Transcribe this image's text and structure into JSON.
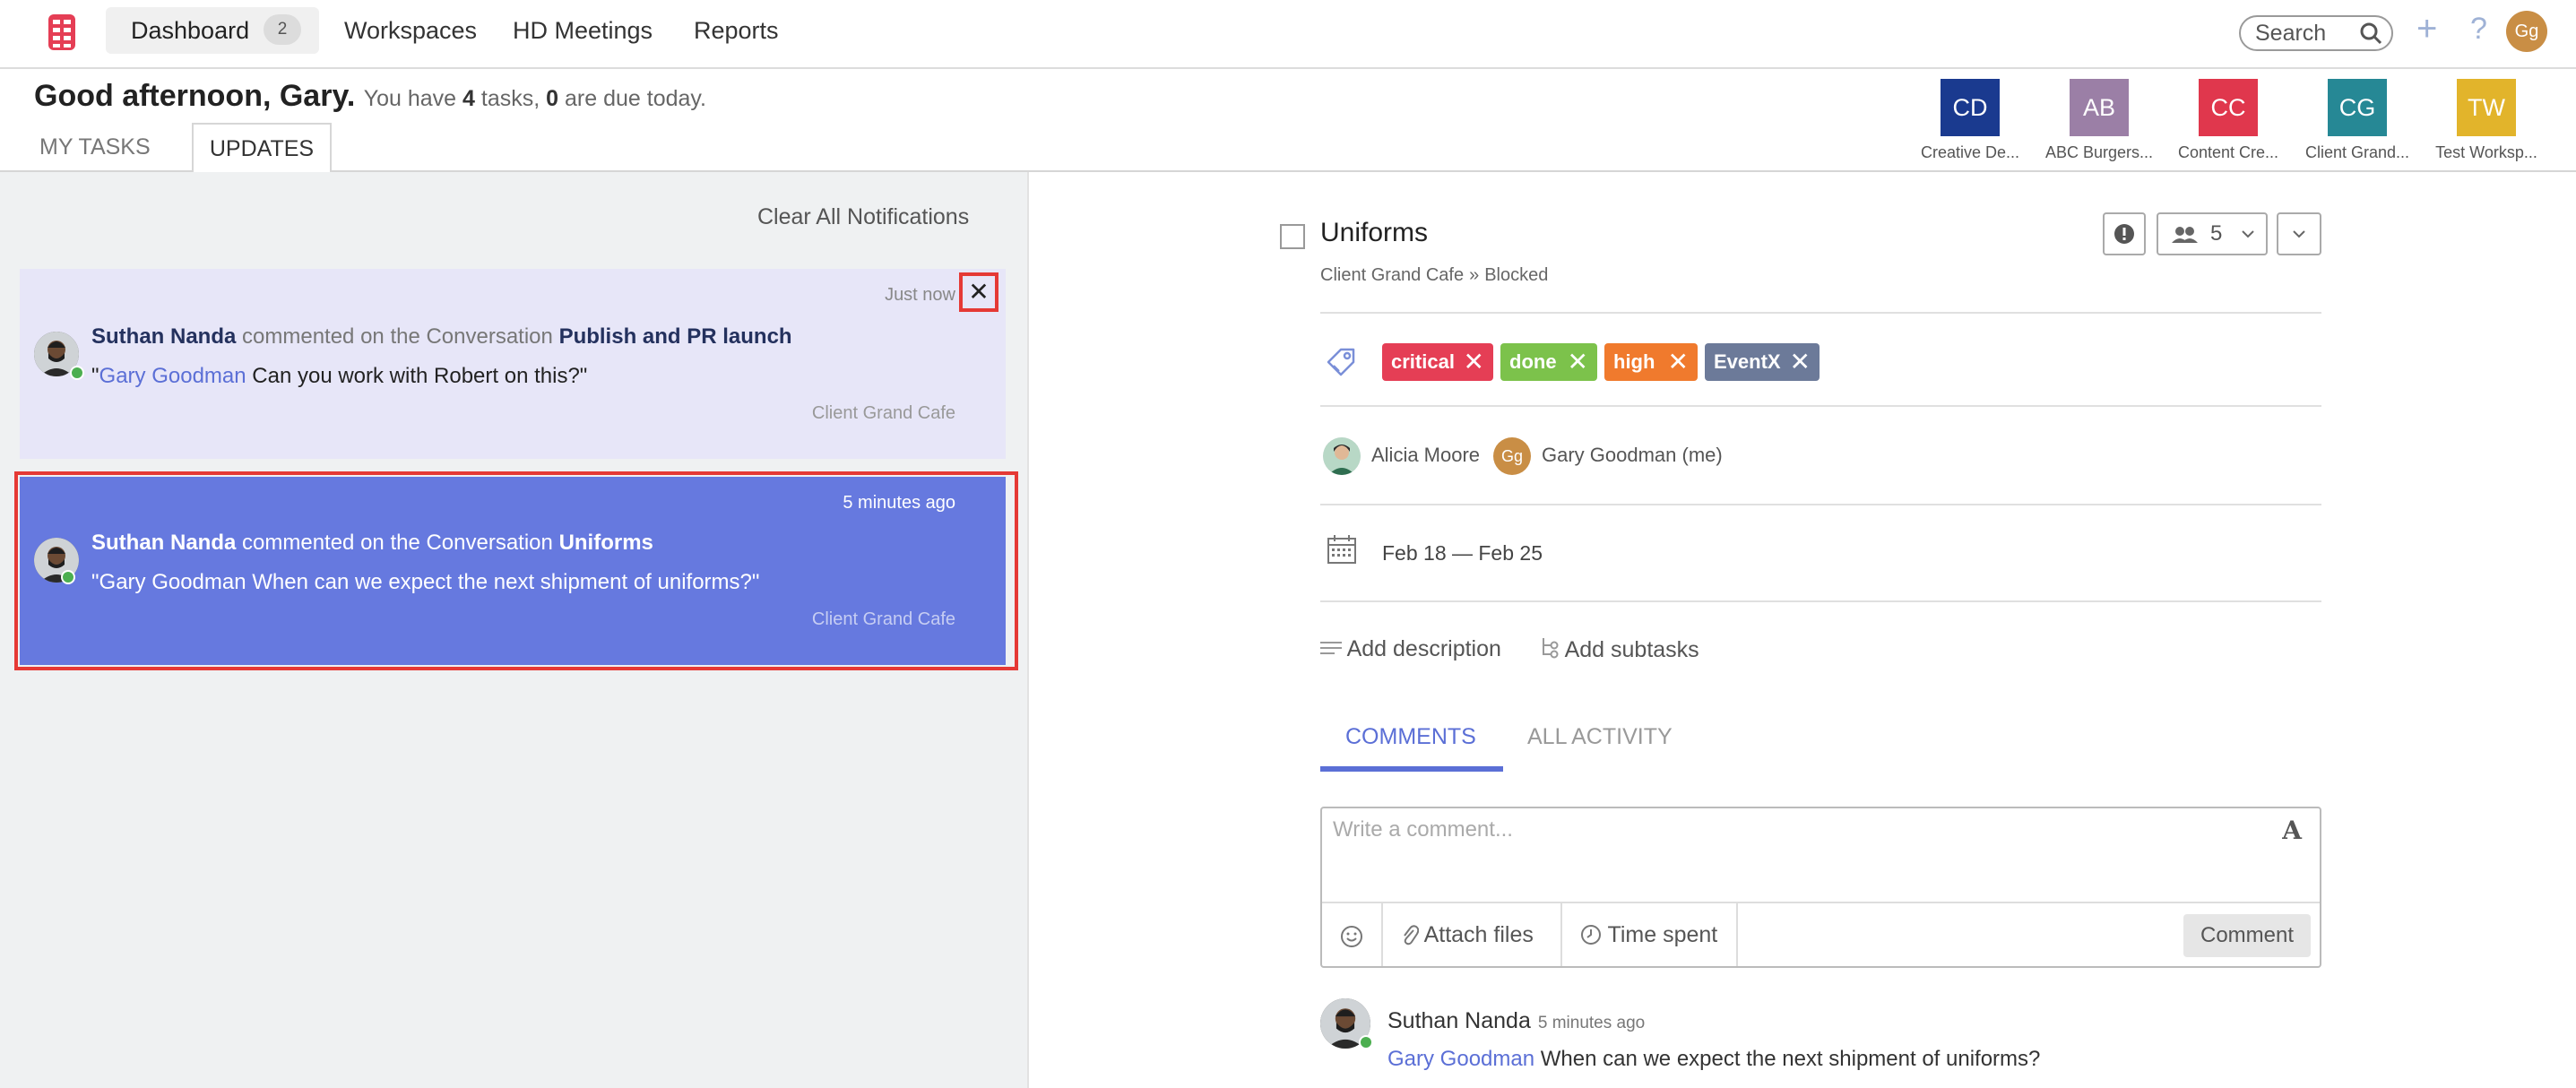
{
  "nav": {
    "dashboard": "Dashboard",
    "dashboard_badge": "2",
    "workspaces": "Workspaces",
    "hd_meetings": "HD Meetings",
    "reports": "Reports",
    "search_placeholder": "Search",
    "plus": "+",
    "help": "?",
    "user_initials": "Gg"
  },
  "greeting": {
    "hello": "Good afternoon, Gary.",
    "you_have": "You have",
    "task_count": "4",
    "tasks_word": "tasks,",
    "due_count": "0",
    "due_text": "are due today."
  },
  "tabs": {
    "my_tasks": "MY TASKS",
    "updates": "UPDATES"
  },
  "workspaces": [
    {
      "initials": "CD",
      "label": "Creative De...",
      "color": "#1a3a8f"
    },
    {
      "initials": "AB",
      "label": "ABC Burgers...",
      "color": "#9b7fa6"
    },
    {
      "initials": "CC",
      "label": "Content Cre...",
      "color": "#e0374d"
    },
    {
      "initials": "CG",
      "label": "Client Grand...",
      "color": "#268895"
    },
    {
      "initials": "TW",
      "label": "Test Worksp...",
      "color": "#e2b42b"
    }
  ],
  "updates": {
    "clear_all": "Clear All Notifications",
    "notifications": [
      {
        "time": "Just now",
        "close": "✕",
        "author": "Suthan Nanda",
        "action": "commented on the Conversation",
        "conversation": "Publish and PR launch",
        "quote_open": "\"",
        "mention": "Gary Goodman",
        "message": "Can you work with Robert on this?\"",
        "workspace": "Client Grand Cafe"
      },
      {
        "time": "5 minutes ago",
        "author": "Suthan Nanda",
        "action": "commented on the Conversation",
        "conversation": "Uniforms",
        "message": "\"Gary Goodman When can we expect the next shipment of uniforms?\"",
        "workspace": "Client Grand Cafe"
      }
    ]
  },
  "task": {
    "title": "Uniforms",
    "workspace": "Client Grand Cafe",
    "separator": "»",
    "status": "Blocked",
    "members_count": "5",
    "tags": [
      {
        "label": "critical",
        "color": "#e53e55"
      },
      {
        "label": "done",
        "color": "#7cc24b"
      },
      {
        "label": "high",
        "color": "#f07a2d"
      },
      {
        "label": "EventX",
        "color": "#6c7a99"
      }
    ],
    "tag_remove": "✕",
    "assignees": [
      {
        "name": "Alicia Moore",
        "initials": ""
      },
      {
        "name": "Gary Goodman (me)",
        "initials": "Gg"
      }
    ],
    "dates": "Feb 18 — Feb 25",
    "add_description": "Add description",
    "add_subtasks": "Add subtasks"
  },
  "comments": {
    "tab_comments": "COMMENTS",
    "tab_activity": "ALL ACTIVITY",
    "placeholder": "Write a comment...",
    "font_icon": "A",
    "attach_files": "Attach files",
    "time_spent": "Time spent",
    "comment_button": "Comment",
    "items": [
      {
        "author": "Suthan Nanda",
        "time": "5 minutes ago",
        "mention": "Gary Goodman",
        "text": "When can we expect the next shipment of uniforms?"
      }
    ]
  }
}
